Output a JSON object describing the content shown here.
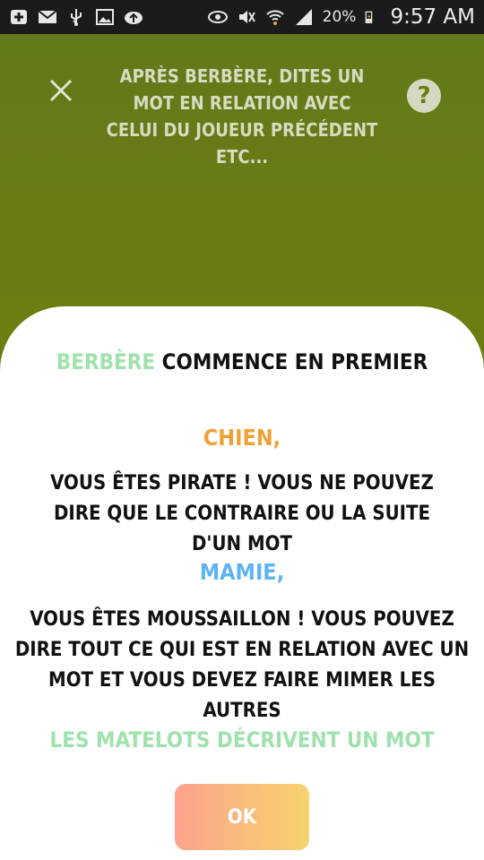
{
  "status_bar": {
    "battery": "20%",
    "time": "9:57 AM",
    "icons": [
      "plus-icon",
      "mail-icon",
      "usb-icon",
      "image-icon",
      "upload-icon",
      "eye-icon",
      "mute-icon",
      "wifi-icon",
      "signal-icon",
      "battery-icon"
    ]
  },
  "header": {
    "instruction": "APRÈS BERBÈRE, DITES UN MOT EN RELATION AVEC CELUI DU JOUEUR PRÉCÉDENT ETC..."
  },
  "sheet": {
    "first_player": "BERBÈRE",
    "first_suffix": " COMMENCE EN PREMIER",
    "role1_name": "CHIEN",
    "role1_comma": ",",
    "role1_desc": "VOUS ÊTES PIRATE ! VOUS NE POUVEZ DIRE QUE LE CONTRAIRE OU LA SUITE D'UN MOT",
    "role2_name": "MAMIE",
    "role2_comma": ",",
    "role2_desc": "VOUS ÊTES MOUSSAILLON ! VOUS POUVEZ DIRE TOUT CE QUI EST EN RELATION AVEC UN MOT ET VOUS DEVEZ FAIRE MIMER LES AUTRES",
    "others_line": "LES MATELOTS DÉCRIVENT UN MOT",
    "ok_label": "OK"
  },
  "colors": {
    "green_accent": "#9fe2ad",
    "orange_accent": "#f0a134",
    "blue_accent": "#5db3f3"
  }
}
